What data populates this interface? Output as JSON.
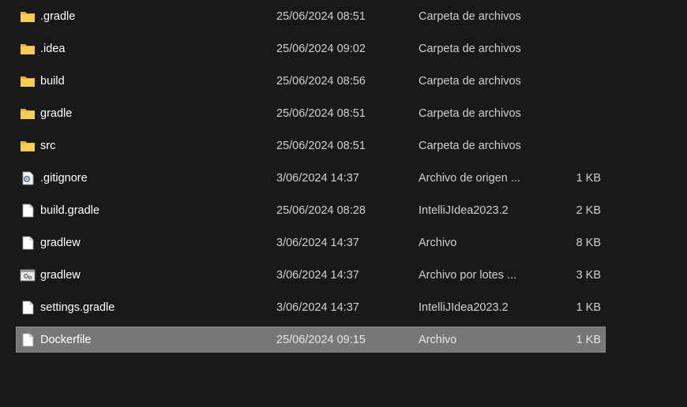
{
  "files": [
    {
      "name": ".gradle",
      "date": "25/06/2024 08:51",
      "type": "Carpeta de archivos",
      "size": "",
      "icon": "folder-icon"
    },
    {
      "name": ".idea",
      "date": "25/06/2024 09:02",
      "type": "Carpeta de archivos",
      "size": "",
      "icon": "folder-icon"
    },
    {
      "name": "build",
      "date": "25/06/2024 08:56",
      "type": "Carpeta de archivos",
      "size": "",
      "icon": "folder-icon"
    },
    {
      "name": "gradle",
      "date": "25/06/2024 08:51",
      "type": "Carpeta de archivos",
      "size": "",
      "icon": "folder-icon"
    },
    {
      "name": "src",
      "date": "25/06/2024 08:51",
      "type": "Carpeta de archivos",
      "size": "",
      "icon": "folder-icon"
    },
    {
      "name": ".gitignore",
      "date": "3/06/2024 14:37",
      "type": "Archivo de origen ...",
      "size": "1 KB",
      "icon": "config-file-icon"
    },
    {
      "name": "build.gradle",
      "date": "25/06/2024 08:28",
      "type": "IntelliJIdea2023.2",
      "size": "2 KB",
      "icon": "file-icon"
    },
    {
      "name": "gradlew",
      "date": "3/06/2024 14:37",
      "type": "Archivo",
      "size": "8 KB",
      "icon": "file-icon"
    },
    {
      "name": "gradlew",
      "date": "3/06/2024 14:37",
      "type": "Archivo por lotes ...",
      "size": "3 KB",
      "icon": "batch-file-icon"
    },
    {
      "name": "settings.gradle",
      "date": "3/06/2024 14:37",
      "type": "IntelliJIdea2023.2",
      "size": "1 KB",
      "icon": "file-icon"
    },
    {
      "name": "Dockerfile",
      "date": "25/06/2024 09:15",
      "type": "Archivo",
      "size": "1 KB",
      "icon": "file-icon",
      "selected": true
    }
  ],
  "colors": {
    "background": "#191919",
    "selection": "#777777",
    "folder": "#f5c242"
  }
}
